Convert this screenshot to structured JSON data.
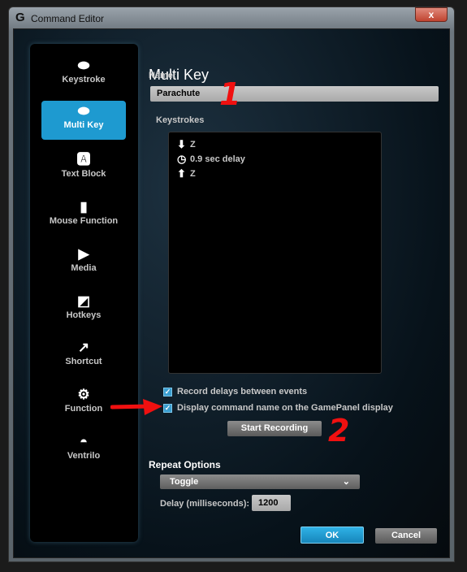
{
  "window": {
    "title": "Command Editor",
    "close": "x"
  },
  "sidebar": {
    "items": [
      {
        "label": "Keystroke",
        "icon": "keycap-icon",
        "active": false
      },
      {
        "label": "Multi Key",
        "icon": "multi-keycap-icon",
        "active": true
      },
      {
        "label": "Text Block",
        "icon": "text-block-icon",
        "active": false
      },
      {
        "label": "Mouse Function",
        "icon": "mouse-icon",
        "active": false
      },
      {
        "label": "Media",
        "icon": "play-icon",
        "active": false
      },
      {
        "label": "Hotkeys",
        "icon": "hotkey-icon",
        "active": false
      },
      {
        "label": "Shortcut",
        "icon": "shortcut-arrow-icon",
        "active": false
      },
      {
        "label": "Function",
        "icon": "function-gear-icon",
        "active": false
      },
      {
        "label": "Ventrilo",
        "icon": "headset-icon",
        "active": false
      }
    ]
  },
  "main": {
    "title": "Multi Key",
    "name_label": "Name:",
    "name_value": "Parachute",
    "keystrokes_label": "Keystrokes",
    "keystrokes": [
      {
        "icon": "arrow-down-icon",
        "text": "Z"
      },
      {
        "icon": "clock-icon",
        "text": "0.9 sec delay"
      },
      {
        "icon": "arrow-up-icon",
        "text": "Z"
      }
    ],
    "record_delays": {
      "label": "Record delays between events",
      "checked": true
    },
    "display_name": {
      "label": "Display command name on the GamePanel display",
      "checked": true
    },
    "start_recording": "Start Recording",
    "repeat_label": "Repeat Options",
    "repeat_value": "Toggle",
    "delay_label": "Delay (milliseconds):",
    "delay_value": "1200",
    "ok": "OK",
    "cancel": "Cancel"
  },
  "annotations": {
    "one": "1",
    "two": "2"
  },
  "colors": {
    "accent": "#1e9ad0",
    "annotation": "#f01010"
  }
}
